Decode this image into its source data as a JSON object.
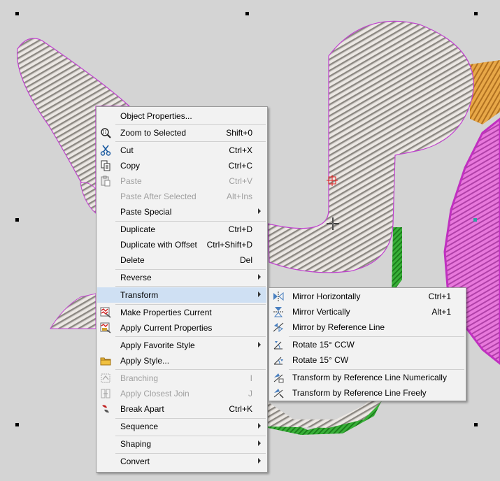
{
  "context_menu": {
    "items": [
      {
        "name": "object-properties",
        "label": "Object Properties...",
        "shortcut": "",
        "icon": "none",
        "disabled": false,
        "submenu": false
      },
      {
        "name": "zoom-to-selected",
        "label": "Zoom to Selected",
        "shortcut": "Shift+0",
        "icon": "zoom-icon",
        "disabled": false,
        "submenu": false
      },
      {
        "name": "cut",
        "label": "Cut",
        "shortcut": "Ctrl+X",
        "icon": "scissors-icon",
        "disabled": false,
        "submenu": false
      },
      {
        "name": "copy",
        "label": "Copy",
        "shortcut": "Ctrl+C",
        "icon": "copy-icon",
        "disabled": false,
        "submenu": false
      },
      {
        "name": "paste",
        "label": "Paste",
        "shortcut": "Ctrl+V",
        "icon": "paste-icon",
        "disabled": true,
        "submenu": false
      },
      {
        "name": "paste-after-selected",
        "label": "Paste After Selected",
        "shortcut": "Alt+Ins",
        "icon": "none",
        "disabled": true,
        "submenu": false
      },
      {
        "name": "paste-special",
        "label": "Paste Special",
        "shortcut": "",
        "icon": "none",
        "disabled": false,
        "submenu": true
      },
      {
        "name": "duplicate",
        "label": "Duplicate",
        "shortcut": "Ctrl+D",
        "icon": "none",
        "disabled": false,
        "submenu": false
      },
      {
        "name": "duplicate-with-offset",
        "label": "Duplicate with Offset",
        "shortcut": "Ctrl+Shift+D",
        "icon": "none",
        "disabled": false,
        "submenu": false
      },
      {
        "name": "delete",
        "label": "Delete",
        "shortcut": "Del",
        "icon": "none",
        "disabled": false,
        "submenu": false
      },
      {
        "name": "reverse",
        "label": "Reverse",
        "shortcut": "",
        "icon": "none",
        "disabled": false,
        "submenu": true
      },
      {
        "name": "transform",
        "label": "Transform",
        "shortcut": "",
        "icon": "none",
        "disabled": false,
        "submenu": true
      },
      {
        "name": "make-properties-current",
        "label": "Make Properties Current",
        "shortcut": "",
        "icon": "make-properties-icon",
        "disabled": false,
        "submenu": false
      },
      {
        "name": "apply-current-properties",
        "label": "Apply Current Properties",
        "shortcut": "",
        "icon": "apply-properties-icon",
        "disabled": false,
        "submenu": false
      },
      {
        "name": "apply-favorite-style",
        "label": "Apply Favorite Style",
        "shortcut": "",
        "icon": "none",
        "disabled": false,
        "submenu": true
      },
      {
        "name": "apply-style",
        "label": "Apply Style...",
        "shortcut": "",
        "icon": "folder-icon",
        "disabled": false,
        "submenu": false
      },
      {
        "name": "branching",
        "label": "Branching",
        "shortcut": "I",
        "icon": "branching-icon",
        "disabled": true,
        "submenu": false
      },
      {
        "name": "apply-closest-join",
        "label": "Apply Closest Join",
        "shortcut": "J",
        "icon": "closest-join-icon",
        "disabled": true,
        "submenu": false
      },
      {
        "name": "break-apart",
        "label": "Break Apart",
        "shortcut": "Ctrl+K",
        "icon": "break-apart-icon",
        "disabled": false,
        "submenu": false
      },
      {
        "name": "sequence",
        "label": "Sequence",
        "shortcut": "",
        "icon": "none",
        "disabled": false,
        "submenu": true
      },
      {
        "name": "shaping",
        "label": "Shaping",
        "shortcut": "",
        "icon": "none",
        "disabled": false,
        "submenu": true
      },
      {
        "name": "convert",
        "label": "Convert",
        "shortcut": "",
        "icon": "none",
        "disabled": false,
        "submenu": true
      }
    ]
  },
  "transform_submenu": {
    "items": [
      {
        "name": "mirror-horizontally",
        "label": "Mirror Horizontally",
        "shortcut": "Ctrl+1",
        "icon": "mirror-horizontal-icon"
      },
      {
        "name": "mirror-vertically",
        "label": "Mirror Vertically",
        "shortcut": "Alt+1",
        "icon": "mirror-vertical-icon"
      },
      {
        "name": "mirror-by-reference-line",
        "label": "Mirror by Reference Line",
        "shortcut": "",
        "icon": "mirror-reference-icon"
      },
      {
        "name": "rotate-15-ccw",
        "label": "Rotate 15° CCW",
        "shortcut": "",
        "icon": "rotate-ccw-icon"
      },
      {
        "name": "rotate-15-cw",
        "label": "Rotate 15° CW",
        "shortcut": "",
        "icon": "rotate-cw-icon"
      },
      {
        "name": "transform-by-reference-line-numerically",
        "label": "Transform by Reference Line Numerically",
        "shortcut": "",
        "icon": "transform-numeric-icon"
      },
      {
        "name": "transform-by-reference-line-freely",
        "label": "Transform by Reference Line Freely",
        "shortcut": "",
        "icon": "transform-free-icon"
      }
    ]
  },
  "colors": {
    "canvas_bg": "#d4d4d4",
    "stitch_white": "#e8e4e0",
    "outline_magenta": "#c03cc8",
    "pink": "#e070d0",
    "orange": "#e0a040",
    "green": "#30a030",
    "menu_bg": "#f2f2f2",
    "highlight": "#cfe0f3"
  }
}
